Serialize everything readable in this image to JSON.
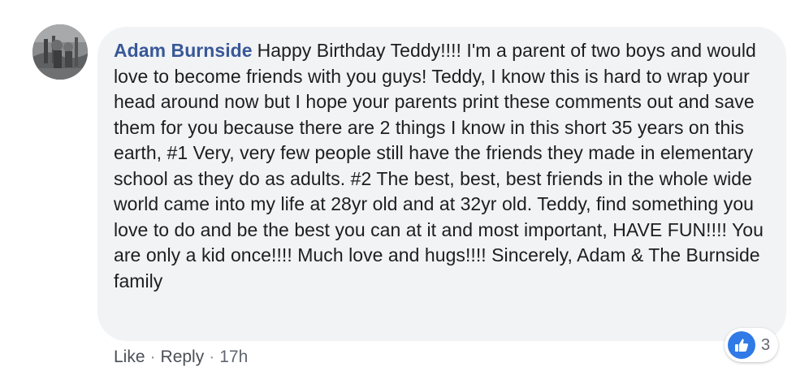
{
  "comment": {
    "author": "Adam Burnside",
    "text": "Happy Birthday Teddy!!!! I'm a parent of two boys and would love to become friends with you guys! Teddy, I know this is hard to wrap your head around now but I hope your parents print these comments out and save them for you because there are 2 things I know in this short 35 years on this earth, #1 Very, very few people still have the friends they made in elementary school as they do as adults. #2 The best, best, best friends in the whole wide world came into my life at 28yr old and at 32yr old. Teddy, find something you love to do and be the best you can at it and most important, HAVE FUN!!!! You are only a kid once!!!! Much love and hugs!!!! Sincerely, Adam & The Burnside family",
    "actions": {
      "like_label": "Like",
      "separator": "·",
      "reply_label": "Reply",
      "timestamp": "17h"
    },
    "reactions": {
      "icon": "thumbs-up-icon",
      "count": "3",
      "color": "#2f7ae6"
    }
  },
  "colors": {
    "author_link": "#385898",
    "bubble_background": "#f2f3f5",
    "body_text": "#1c1e21",
    "meta_text": "#616770"
  }
}
